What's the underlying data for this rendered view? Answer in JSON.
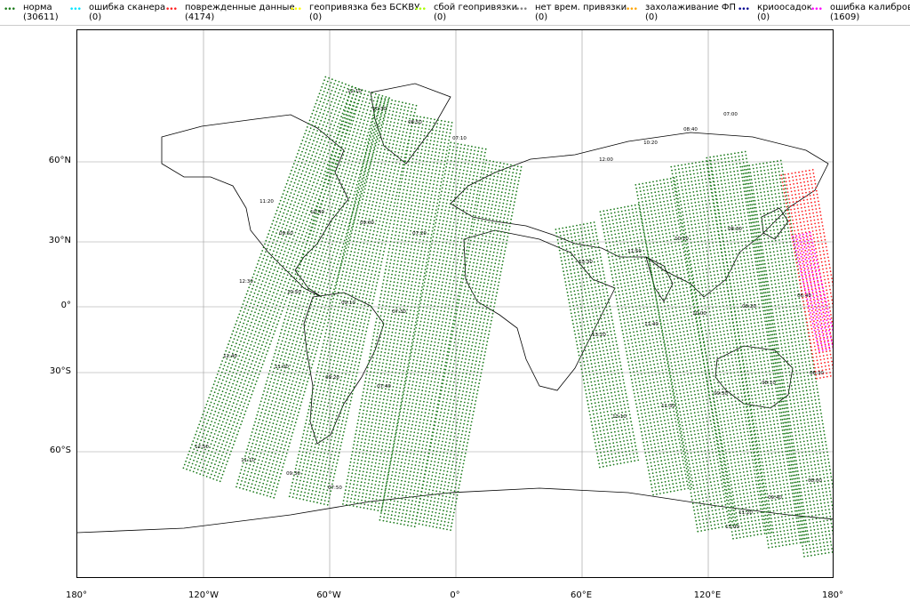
{
  "legend": [
    {
      "label": "норма",
      "count": "(30611)",
      "color": "#1a7a1a"
    },
    {
      "label": "ошибка сканера",
      "count": "(0)",
      "color": "#00e5ff"
    },
    {
      "label": "поврежденные данные",
      "count": "(4174)",
      "color": "#ff2020"
    },
    {
      "label": "геопривязка без БСКВУ",
      "count": "(0)",
      "color": "#ffff00"
    },
    {
      "label": "сбой геопривязки",
      "count": "(0)",
      "color": "#aaff00"
    },
    {
      "label": "нет врем. привязки",
      "count": "(0)",
      "color": "#808080"
    },
    {
      "label": "захолаживание ФП",
      "count": "(0)",
      "color": "#ffa500"
    },
    {
      "label": "криоосадок",
      "count": "(0)",
      "color": "#000090"
    },
    {
      "label": "ошибка калибровки",
      "count": "(1609)",
      "color": "#ff00ff"
    }
  ],
  "axes": {
    "lat_ticks": [
      "60°N",
      "30°N",
      "0°",
      "30°S",
      "60°S"
    ],
    "lon_ticks": [
      "180°",
      "120°W",
      "60°W",
      "0°",
      "60°E",
      "120°E",
      "180°"
    ]
  },
  "swath_times": [
    "12:10",
    "10:30",
    "08:50",
    "07:10",
    "07:00",
    "08:40",
    "10:20",
    "12:00",
    "11:20",
    "10:40",
    "09:00",
    "07:20",
    "09:50",
    "08:30",
    "10:10",
    "11:50",
    "13:30",
    "12:30",
    "10:50",
    "09:10",
    "07:30",
    "08:20",
    "06:40",
    "10:00",
    "11:40",
    "13:20",
    "12:40",
    "11:00",
    "09:20",
    "07:40",
    "09:50",
    "08:10",
    "06:30",
    "11:30",
    "13:10",
    "12:50",
    "11:10",
    "09:30",
    "07:50",
    "08:00",
    "09:40",
    "11:20",
    "13:00"
  ]
}
